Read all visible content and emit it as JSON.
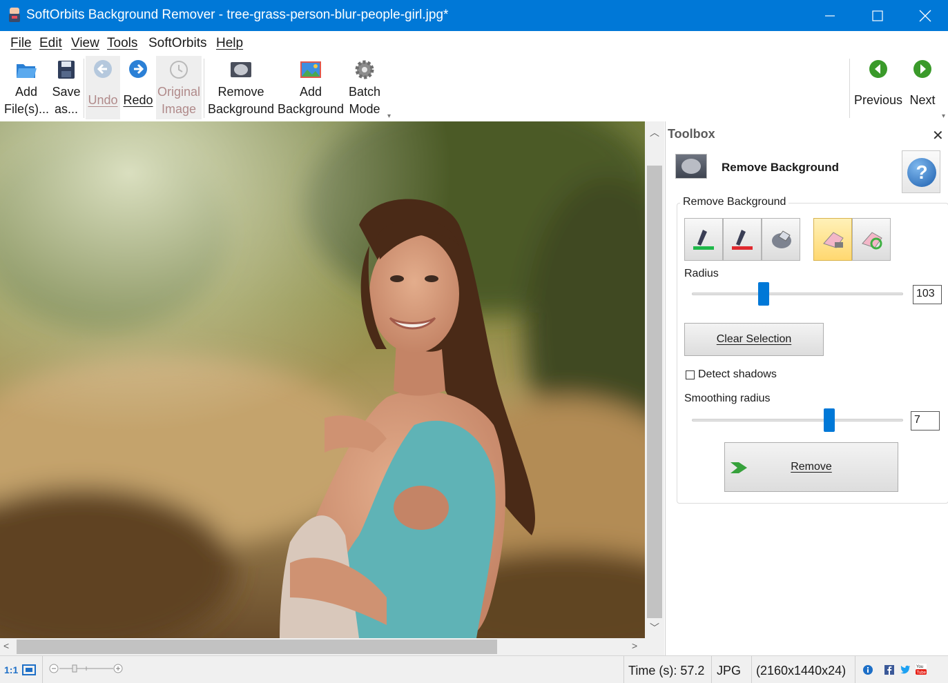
{
  "window": {
    "title": "SoftOrbits Background Remover - tree-grass-person-blur-people-girl.jpg*",
    "controls": [
      "minimize",
      "maximize",
      "close"
    ]
  },
  "menu": {
    "file": "File",
    "edit": "Edit",
    "view": "View",
    "tools": "Tools",
    "softorbits": "SoftOrbits",
    "help": "Help"
  },
  "toolbar": {
    "add_files": [
      "Add",
      "File(s)..."
    ],
    "save_as": [
      "Save",
      "as..."
    ],
    "undo": "Undo",
    "redo": "Redo",
    "original_image": [
      "Original",
      "Image"
    ],
    "remove_background": [
      "Remove",
      "Background"
    ],
    "add_background": [
      "Add",
      "Background"
    ],
    "batch_mode": [
      "Batch",
      "Mode"
    ],
    "previous": "Previous",
    "next": "Next"
  },
  "toolbox": {
    "title": "Toolbox",
    "header": "Remove Background",
    "group_label": "Remove Background",
    "tools": [
      "keep-marker (green)",
      "remove-marker (red)",
      "eraser-lasso",
      "eraser (active)",
      "restore-eraser"
    ],
    "radius_label": "Radius",
    "radius_value": "103",
    "radius_fraction": 0.34,
    "clear_selection": "Clear Selection",
    "detect_shadows_label": "Detect shadows",
    "detect_shadows_checked": false,
    "smoothing_label": "Smoothing radius",
    "smoothing_value": "7",
    "smoothing_fraction": 0.65,
    "remove_button": "Remove"
  },
  "status": {
    "zoom_1to1": "1:1",
    "time": "Time (s): 57.2",
    "format": "JPG",
    "dimensions": "(2160x1440x24)",
    "social_icons": [
      "info-icon",
      "facebook-icon",
      "twitter-icon",
      "youtube-icon"
    ]
  },
  "colors": {
    "titlebar": "#0078d7",
    "accent": "#0078d7",
    "active_tool": "#ffd870"
  }
}
